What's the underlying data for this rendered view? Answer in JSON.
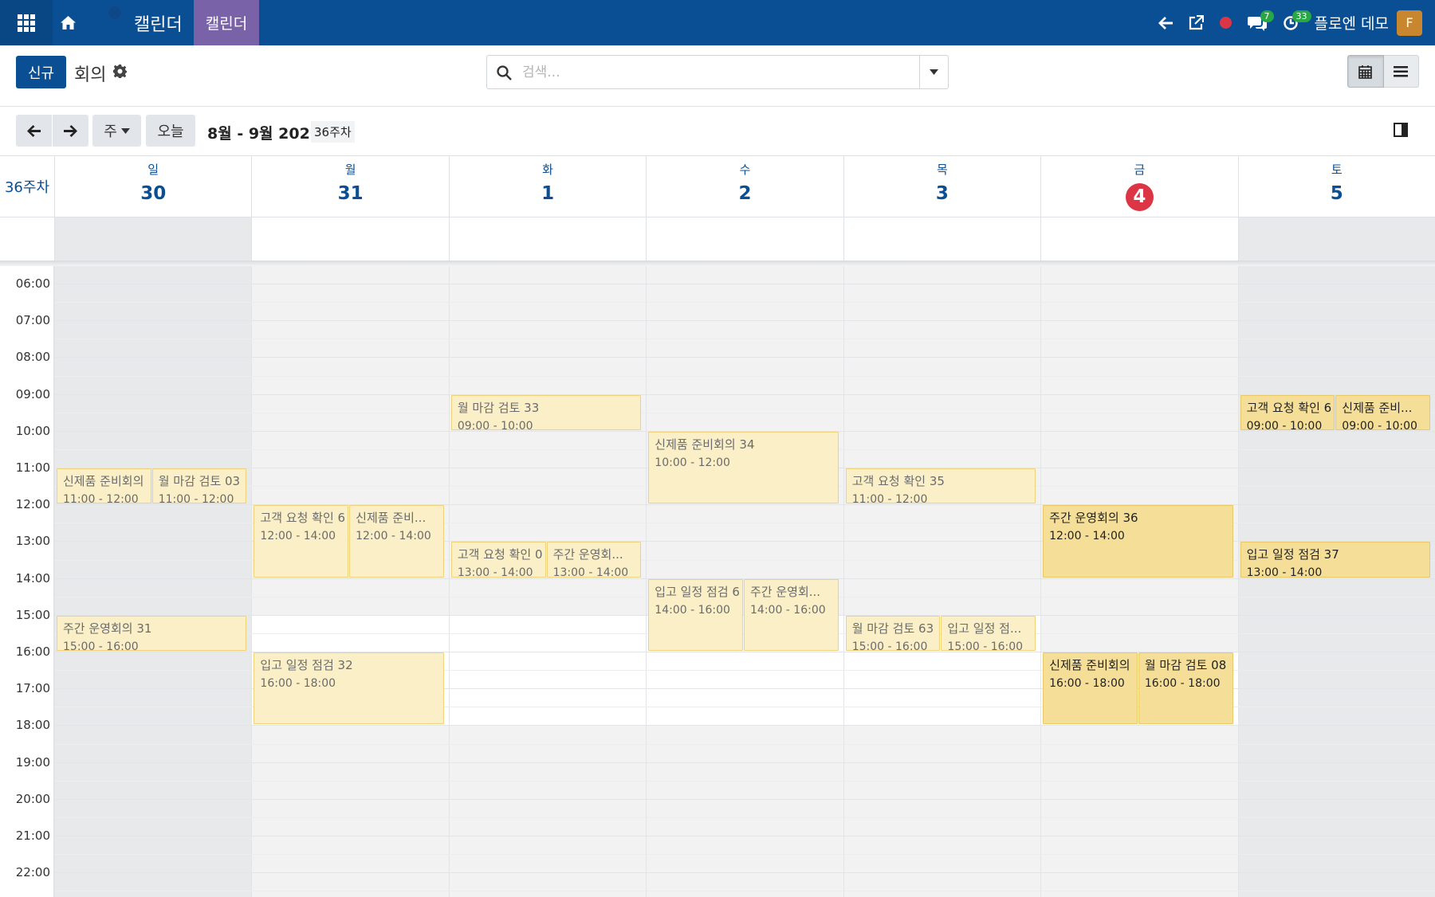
{
  "navbar": {
    "brand": "캘린더",
    "menu": "캘린더",
    "messages_count": "7",
    "activities_count": "33",
    "user_name": "플로엔 데모",
    "avatar_letter": "F"
  },
  "control": {
    "new_label": "신규",
    "breadcrumb": "회의",
    "search_placeholder": "검색...",
    "scale_label": "주",
    "today_label": "오늘",
    "range_label": "8월 - 9월 2026",
    "week_badge": "36주차"
  },
  "calendar": {
    "week_label": "36주차",
    "days": [
      {
        "name": "일",
        "date": "30"
      },
      {
        "name": "월",
        "date": "31"
      },
      {
        "name": "화",
        "date": "1"
      },
      {
        "name": "수",
        "date": "2"
      },
      {
        "name": "목",
        "date": "3"
      },
      {
        "name": "금",
        "date": "4",
        "today": true
      },
      {
        "name": "토",
        "date": "5"
      }
    ],
    "hours": [
      "06:00",
      "07:00",
      "08:00",
      "09:00",
      "10:00",
      "11:00",
      "12:00",
      "13:00",
      "14:00",
      "15:00",
      "16:00",
      "17:00",
      "18:00",
      "19:00",
      "20:00",
      "21:00",
      "22:00"
    ],
    "events": [
      {
        "day": 0,
        "title": "신제품 준비회의",
        "time": "11:00 - 12:00",
        "start": 11,
        "end": 12,
        "col": 0,
        "cols": 2,
        "strong": false
      },
      {
        "day": 0,
        "title": "월 마감 검토 03",
        "time": "11:00 - 12:00",
        "start": 11,
        "end": 12,
        "col": 1,
        "cols": 2,
        "strong": false
      },
      {
        "day": 0,
        "title": "주간 운영회의 31",
        "time": "15:00 - 16:00",
        "start": 15,
        "end": 16,
        "col": 0,
        "cols": 1,
        "strong": false
      },
      {
        "day": 1,
        "title": "고객 요청 확인 6",
        "time": "12:00 - 14:00",
        "start": 12,
        "end": 14,
        "col": 0,
        "cols": 2,
        "strong": false
      },
      {
        "day": 1,
        "title": "신제품 준비...",
        "time": "12:00 - 14:00",
        "start": 12,
        "end": 14,
        "col": 1,
        "cols": 2,
        "strong": false
      },
      {
        "day": 1,
        "title": "입고 일정 점검 32",
        "time": "16:00 - 18:00",
        "start": 16,
        "end": 18,
        "col": 0,
        "cols": 1,
        "strong": false
      },
      {
        "day": 2,
        "title": "월 마감 검토 33",
        "time": "09:00 - 10:00",
        "start": 9,
        "end": 10,
        "col": 0,
        "cols": 1,
        "strong": false
      },
      {
        "day": 2,
        "title": "고객 요청 확인 0",
        "time": "13:00 - 14:00",
        "start": 13,
        "end": 14,
        "col": 0,
        "cols": 2,
        "strong": false
      },
      {
        "day": 2,
        "title": "주간 운영회...",
        "time": "13:00 - 14:00",
        "start": 13,
        "end": 14,
        "col": 1,
        "cols": 2,
        "strong": false
      },
      {
        "day": 3,
        "title": "신제품 준비회의 34",
        "time": "10:00 - 12:00",
        "start": 10,
        "end": 12,
        "col": 0,
        "cols": 1,
        "strong": false
      },
      {
        "day": 3,
        "title": "입고 일정 점검 6",
        "time": "14:00 - 16:00",
        "start": 14,
        "end": 16,
        "col": 0,
        "cols": 2,
        "strong": false
      },
      {
        "day": 3,
        "title": "주간 운영회...",
        "time": "14:00 - 16:00",
        "start": 14,
        "end": 16,
        "col": 1,
        "cols": 2,
        "strong": false
      },
      {
        "day": 4,
        "title": "고객 요청 확인 35",
        "time": "11:00 - 12:00",
        "start": 11,
        "end": 12,
        "col": 0,
        "cols": 1,
        "strong": false
      },
      {
        "day": 4,
        "title": "월 마감 검토 63",
        "time": "15:00 - 16:00",
        "start": 15,
        "end": 16,
        "col": 0,
        "cols": 2,
        "strong": false
      },
      {
        "day": 4,
        "title": "입고 일정 점...",
        "time": "15:00 - 16:00",
        "start": 15,
        "end": 16,
        "col": 1,
        "cols": 2,
        "strong": false
      },
      {
        "day": 5,
        "title": "주간 운영회의 36",
        "time": "12:00 - 14:00",
        "start": 12,
        "end": 14,
        "col": 0,
        "cols": 1,
        "strong": true
      },
      {
        "day": 5,
        "title": "신제품 준비회의",
        "time": "16:00 - 18:00",
        "start": 16,
        "end": 18,
        "col": 0,
        "cols": 2,
        "strong": true
      },
      {
        "day": 5,
        "title": "월 마감 검토 08",
        "time": "16:00 - 18:00",
        "start": 16,
        "end": 18,
        "col": 1,
        "cols": 2,
        "strong": true
      },
      {
        "day": 6,
        "title": "고객 요청 확인 6",
        "time": "09:00 - 10:00",
        "start": 9,
        "end": 10,
        "col": 0,
        "cols": 2,
        "strong": true
      },
      {
        "day": 6,
        "title": "신제품 준비...",
        "time": "09:00 - 10:00",
        "start": 9,
        "end": 10,
        "col": 1,
        "cols": 2,
        "strong": true
      },
      {
        "day": 6,
        "title": "입고 일정 점검 37",
        "time": "13:00 - 14:00",
        "start": 13,
        "end": 14,
        "col": 0,
        "cols": 1,
        "strong": true
      }
    ]
  }
}
